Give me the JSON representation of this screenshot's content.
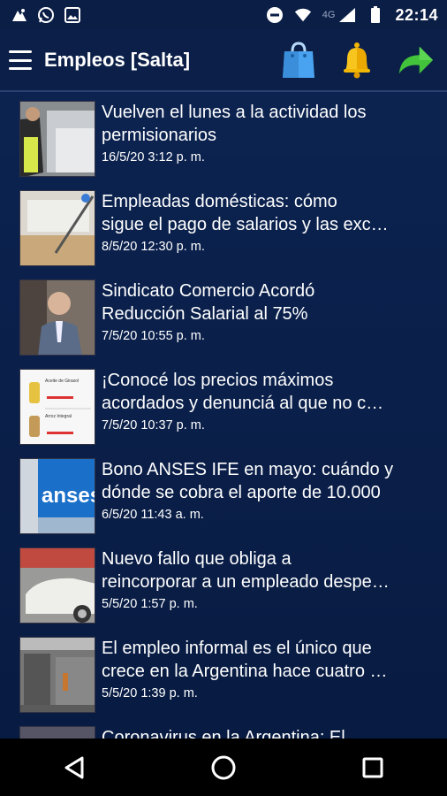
{
  "status_bar": {
    "network": "4G",
    "time": "22:14"
  },
  "app_bar": {
    "title": "Empleos [Salta]"
  },
  "colors": {
    "background": "#0b1f48",
    "accent_bag": "#4aa3f0",
    "bell": "#f2b705",
    "share": "#43c33b"
  },
  "articles": [
    {
      "title_lines": [
        "Vuelven el lunes a la actividad los",
        "permisionarios"
      ],
      "date": "16/5/20 3:12 p. m."
    },
    {
      "title_lines": [
        "Empleadas domésticas: cómo",
        "sigue el pago de salarios y las exc…"
      ],
      "date": "8/5/20 12:30 p. m."
    },
    {
      "title_lines": [
        "Sindicato Comercio Acordó",
        "Reducción Salarial al 75%"
      ],
      "date": "7/5/20 10:55 p. m."
    },
    {
      "title_lines": [
        "¡Conocé los precios máximos",
        "acordados y denunciá al que no c…"
      ],
      "date": "7/5/20 10:37 p. m."
    },
    {
      "title_lines": [
        "Bono ANSES IFE en mayo: cuándo y",
        "dónde se cobra el aporte de 10.000"
      ],
      "date": "6/5/20 11:43 a. m."
    },
    {
      "title_lines": [
        "Nuevo fallo que obliga a",
        "reincorporar a un empleado despe…"
      ],
      "date": "5/5/20 1:57 p. m."
    },
    {
      "title_lines": [
        "El empleo informal es el único que",
        "crece en la Argentina hace cuatro …"
      ],
      "date": "5/5/20 1:39 p. m."
    },
    {
      "title_lines": [
        "Coronavirus en la Argentina: El",
        ""
      ],
      "date": ""
    }
  ],
  "thumb_text": {
    "anses": "anses",
    "price_card_1": "Aceite de Girasol",
    "price_card_2": "Arroz Integral"
  }
}
